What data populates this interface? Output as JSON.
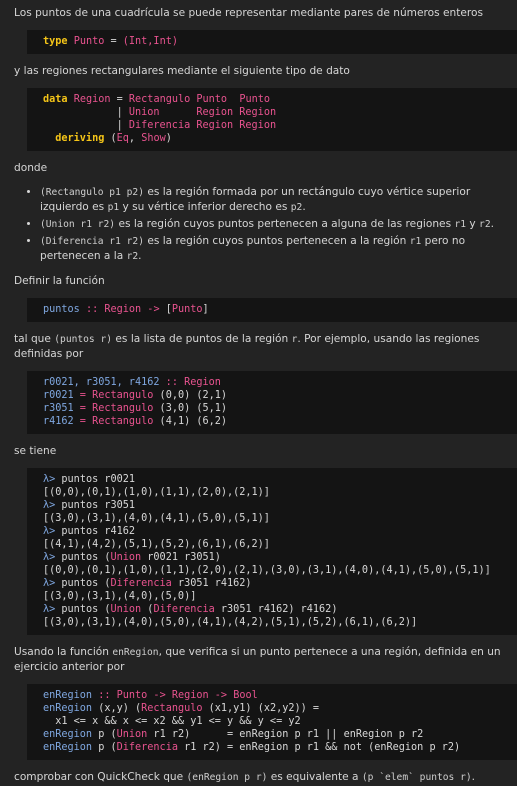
{
  "p1": "Los puntos de una cuadrícula se puede representar mediante pares de números enteros",
  "code1": {
    "kw": "type",
    "name": "Punto",
    "eq": " = ",
    "rhs": "(Int,Int)"
  },
  "p2": "y las regiones rectangulares mediante el siguiente tipo de dato",
  "code2": {
    "l1_kw": "data",
    "l1_name": "Region",
    "l1_eq": " = ",
    "l1_con": "Rectangulo",
    "l1_a": " Punto  Punto",
    "l2_bar": "            | ",
    "l2_con": "Union     ",
    "l2_a": " Region Region",
    "l3_bar": "            | ",
    "l3_con": "Diferencia",
    "l3_a": " Region Region",
    "l4_kw": "  deriving",
    "l4_a": " (",
    "l4_b": "Eq",
    "l4_c": ", ",
    "l4_d": "Show",
    "l4_e": ")"
  },
  "p3": "donde",
  "bullets": [
    {
      "code": "(Rectangulo p1 p2)",
      "text": " es la región formada por un rectángulo cuyo vértice superior izquierdo es ",
      "c2": "p1",
      "t2": " y su vértice inferior derecho es ",
      "c3": "p2",
      "t3": "."
    },
    {
      "code": "(Union r1 r2)",
      "text": " es la región cuyos puntos pertenecen a alguna de las regiones ",
      "c2": "r1",
      "t2": " y ",
      "c3": "r2",
      "t3": "."
    },
    {
      "code": "(Diferencia r1 r2)",
      "text": " es la región cuyos puntos pertenecen a la región ",
      "c2": "r1",
      "t2": " pero no pertenecen a la ",
      "c3": "r2",
      "t3": "."
    }
  ],
  "p4": "Definir la función",
  "code3": {
    "name": "puntos",
    "sig": " :: ",
    "a": "Region",
    "arrow": " -> ",
    "b": "[",
    "c": "Punto",
    "d": "]"
  },
  "p5": {
    "a": "tal que ",
    "code": "(puntos r)",
    "b": " es la lista de puntos de la región ",
    "code2": "r",
    "c": ". Por ejemplo, usando las regiones definidas por"
  },
  "code4": {
    "l1_a": "r0021, r3051, r4162",
    "l1_sig": " :: ",
    "l1_t": "Region",
    "l2_n": "r0021",
    "l2_eq": " = ",
    "l2_c": "Rectangulo",
    "l2_a": " (0,0) (2,1)",
    "l3_n": "r3051",
    "l3_eq": " = ",
    "l3_c": "Rectangulo",
    "l3_a": " (3,0) (5,1)",
    "l4_n": "r4162",
    "l4_eq": " = ",
    "l4_c": "Rectangulo",
    "l4_a": " (4,1) (6,2)"
  },
  "p6": "se tiene",
  "code5": {
    "prompt": "λ>",
    "q1": " puntos r0021",
    "r1": "[(0,0),(0,1),(1,0),(1,1),(2,0),(2,1)]",
    "q2": " puntos r3051",
    "r2": "[(3,0),(3,1),(4,0),(4,1),(5,0),(5,1)]",
    "q3": " puntos r4162",
    "r3": "[(4,1),(4,2),(5,1),(5,2),(6,1),(6,2)]",
    "q4a": " puntos (",
    "q4c": "Union",
    "q4b": " r0021 r3051)",
    "r4": "[(0,0),(0,1),(1,0),(1,1),(2,0),(2,1),(3,0),(3,1),(4,0),(4,1),(5,0),(5,1)]",
    "q5a": " puntos (",
    "q5c": "Diferencia",
    "q5b": " r3051 r4162)",
    "r5": "[(3,0),(3,1),(4,0),(5,0)]",
    "q6a": " puntos (",
    "q6c": "Union",
    "q6d": " (",
    "q6e": "Diferencia",
    "q6b": " r3051 r4162) r4162)",
    "r6": "[(3,0),(3,1),(4,0),(5,0),(4,1),(4,2),(5,1),(5,2),(6,1),(6,2)]"
  },
  "p7": {
    "a": "Usando la función ",
    "code": "enRegion",
    "b": ", que verifica si un punto pertenece a una región, definida en un ejercicio anterior por"
  },
  "code6": {
    "l1_n": "enRegion",
    "l1_sig": " :: ",
    "l1_a": "Punto",
    "l1_ar": " -> ",
    "l1_b": "Region",
    "l1_ar2": " -> ",
    "l1_c": "Bool",
    "l2_n": "enRegion",
    "l2_a": " (x,y) (",
    "l2_c": "Rectangulo",
    "l2_b": " (x1,y1) (x2,y2)) =",
    "l3": "  x1 <= x && x <= x2 && y1 <= y && y <= y2",
    "l4_n": "enRegion",
    "l4_a": " p (",
    "l4_c": "Union",
    "l4_b": " r1 r2)      = enRegion p r1 || enRegion p r2",
    "l5_n": "enRegion",
    "l5_a": " p (",
    "l5_c": "Diferencia",
    "l5_b": " r1 r2) = enRegion p r1 && not (enRegion p r2)"
  },
  "p8": {
    "a": "comprobar con QuickCheck que ",
    "code": "(enRegion p r)",
    "b": " es equivalente a ",
    "code2": "(p `elem` puntos r)",
    "c": "."
  }
}
